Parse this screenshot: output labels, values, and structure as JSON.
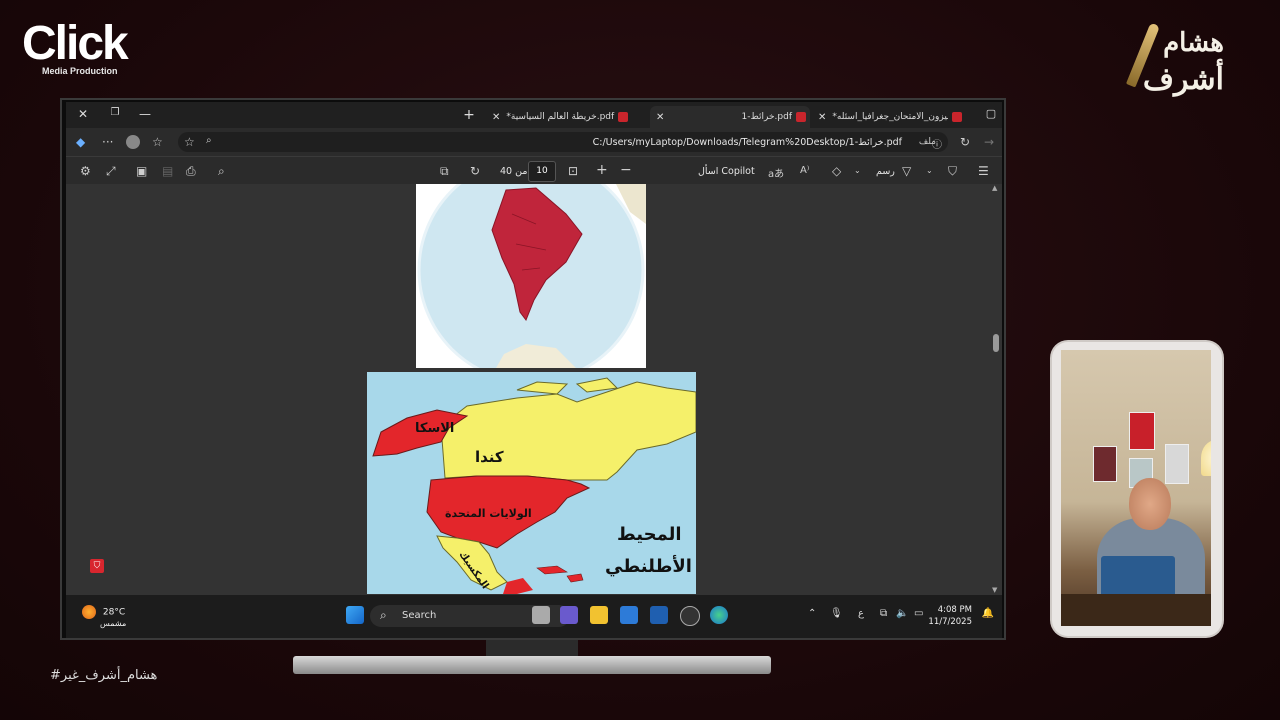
{
  "overlay": {
    "brand_word": "Click",
    "brand_sub": "Media Production",
    "signature_line1": "هشام",
    "signature_line2": "أشرف",
    "hashtag": "#هشام_أشرف_غير"
  },
  "browser": {
    "tabs": [
      {
        "label": "*المتميزون_الامتحان_جغرافيا_اسئله.",
        "active": false
      },
      {
        "label": "خرائط-1.pdf",
        "active": true
      },
      {
        "label": "*خريطة العالم السياسية.pdf",
        "active": false
      }
    ],
    "address": {
      "url": "C:/Users/myLaptop/Downloads/Telegram%20Desktop/1-خرائط.pdf",
      "scheme_label": "ملف"
    }
  },
  "pdf_toolbar": {
    "current_page": "10",
    "page_total_label": "من 40",
    "copilot_label": "اسأل Copilot",
    "draw_label": "رسم",
    "zoom_in": "+",
    "zoom_out": "−"
  },
  "map": {
    "labels": {
      "alaska": "الاسكا",
      "canada": "كندا",
      "usa": "الولايات المتحدة",
      "atlantic_line1": "المحيط",
      "atlantic_line2": "الأطلنطي",
      "mexico": "المكسيك"
    },
    "colors": {
      "red": "#e3262b",
      "yellow": "#f5f06a",
      "ocean": "#a8d8ea"
    }
  },
  "taskbar": {
    "temperature": "28°C",
    "weather_desc": "مشمس",
    "search_placeholder": "Search",
    "lang": "ع",
    "time": "4:08 PM",
    "date": "11/7/2025"
  }
}
